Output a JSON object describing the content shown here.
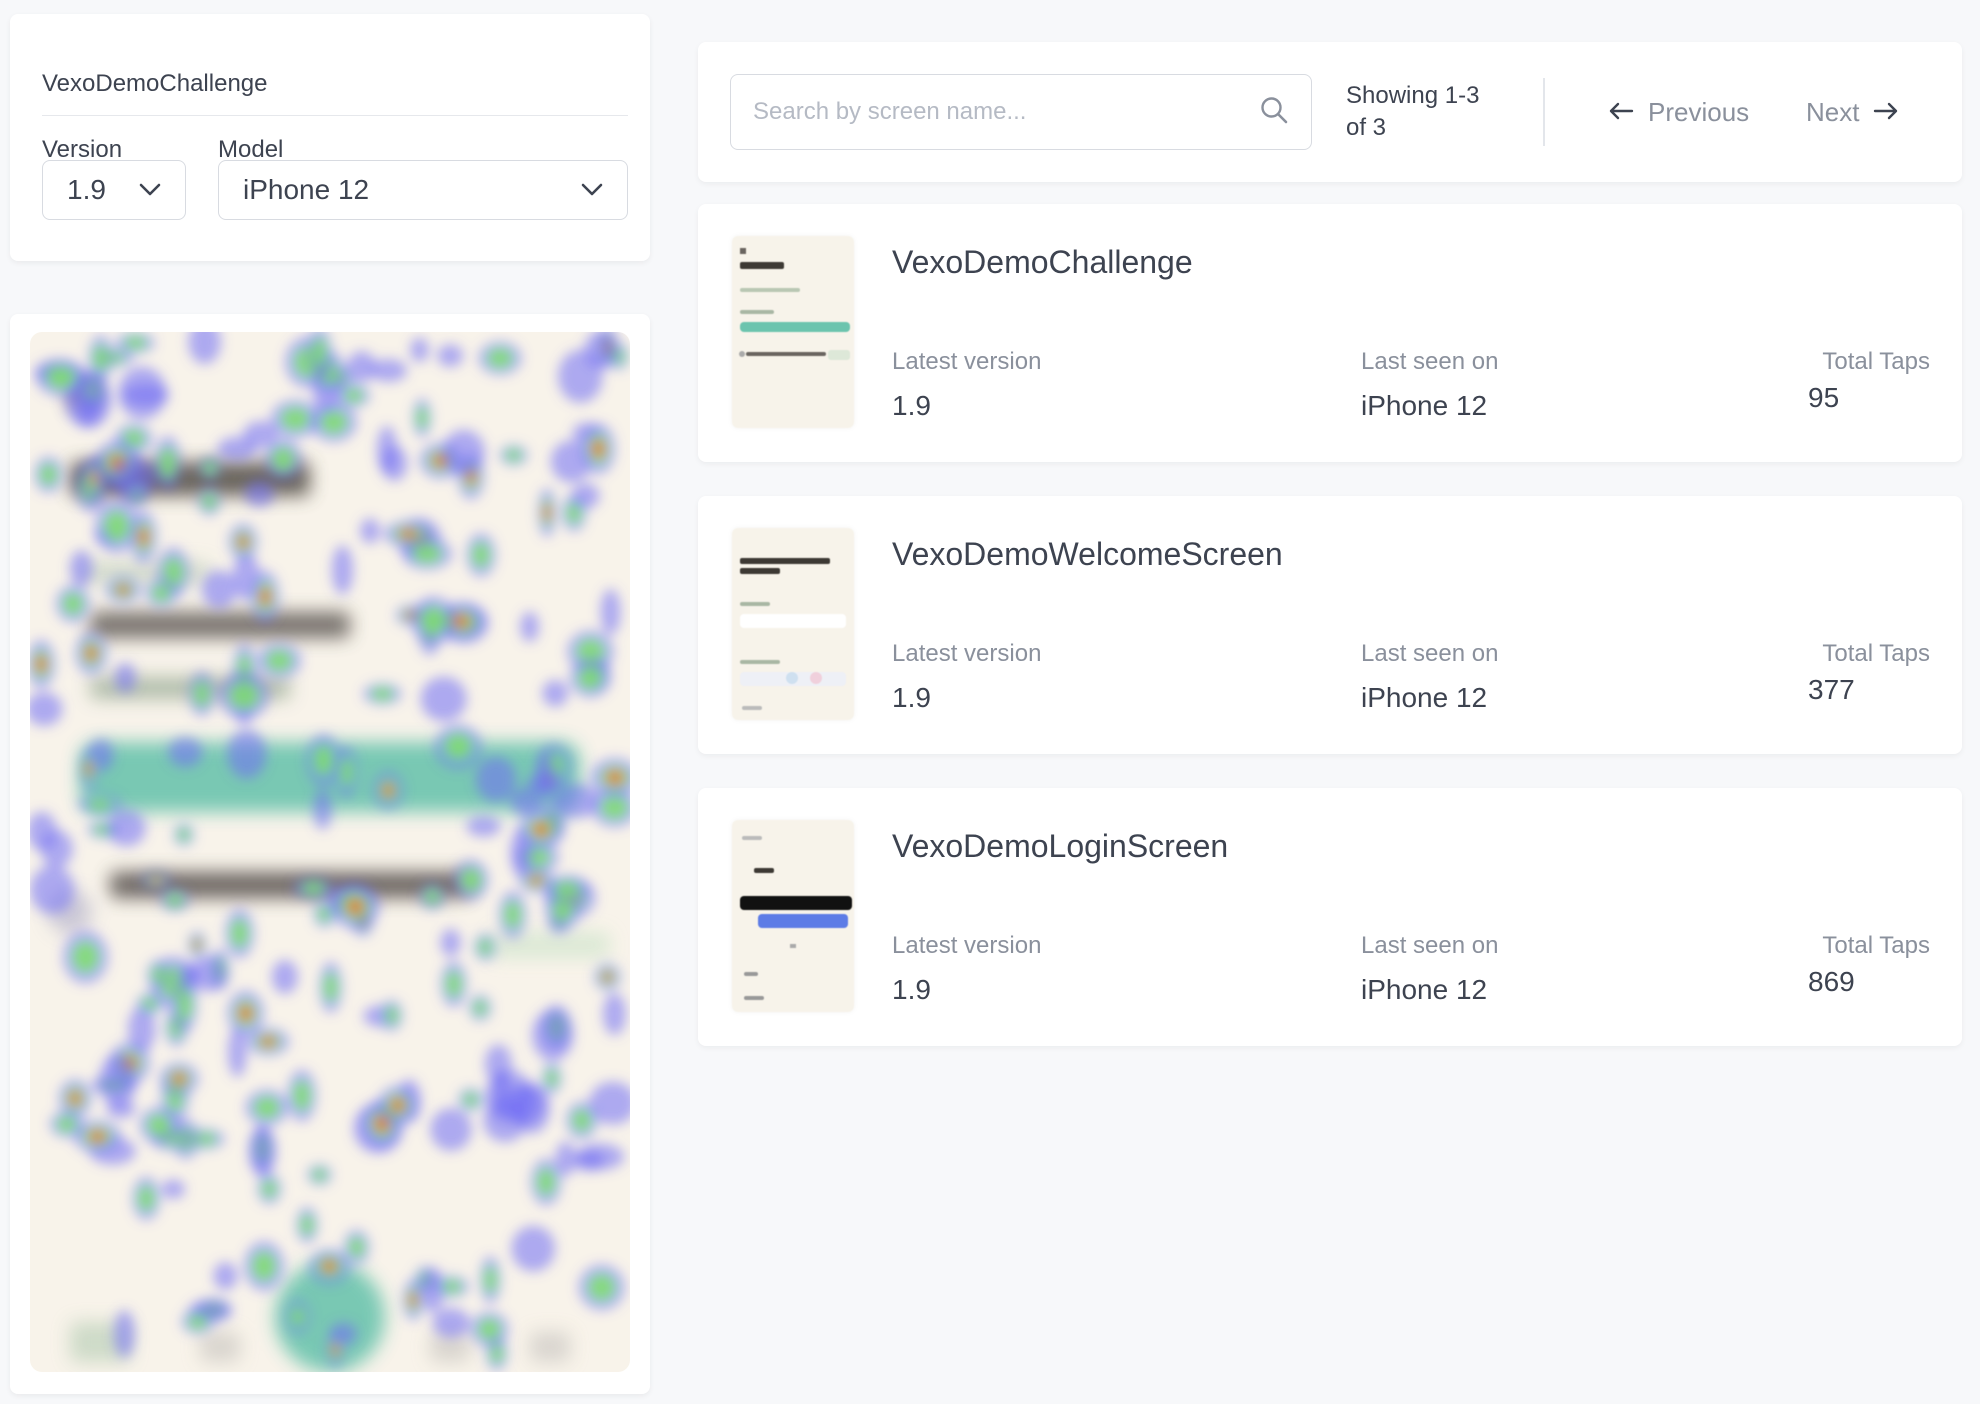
{
  "filters": {
    "title": "VexoDemoChallenge",
    "version_label": "Version",
    "version_value": "1.9",
    "model_label": "Model",
    "model_value": "iPhone 12"
  },
  "heatmap": {
    "colors": {
      "low": "#6f6cf4",
      "mid": "#7fe36b",
      "high": "#f25c3a"
    }
  },
  "toolbar": {
    "search_placeholder": "Search by screen name...",
    "showing_text": "Showing 1-3 of 3",
    "previous_label": "Previous",
    "next_label": "Next"
  },
  "screens": [
    {
      "name": "VexoDemoChallenge",
      "latest_version_label": "Latest version",
      "latest_version": "1.9",
      "last_seen_label": "Last seen on",
      "last_seen": "iPhone 12",
      "taps_label": "Total Taps",
      "total_taps": "95"
    },
    {
      "name": "VexoDemoWelcomeScreen",
      "latest_version_label": "Latest version",
      "latest_version": "1.9",
      "last_seen_label": "Last seen on",
      "last_seen": "iPhone 12",
      "taps_label": "Total Taps",
      "total_taps": "377"
    },
    {
      "name": "VexoDemoLoginScreen",
      "latest_version_label": "Latest version",
      "latest_version": "1.9",
      "last_seen_label": "Last seen on",
      "last_seen": "iPhone 12",
      "taps_label": "Total Taps",
      "total_taps": "869"
    }
  ],
  "colors": {
    "page_background": "#f7f8fa",
    "card_background": "#ffffff",
    "text_primary": "#3d4350",
    "text_muted": "#8a909c",
    "accent_teal": "#6cc4ae"
  }
}
